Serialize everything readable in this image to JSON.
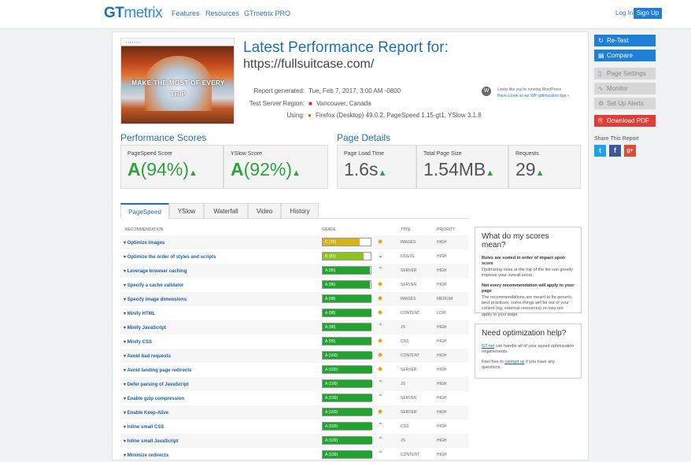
{
  "header": {
    "logo_gt": "GT",
    "logo_rest": "metrix",
    "nav": [
      "Features",
      "Resources",
      "GTmetrix PRO"
    ],
    "login": "Log In",
    "signup": "Sign Up"
  },
  "thumbnail": {
    "headline1": "MAKE THE MOST OF EVERY",
    "headline2": "TRIP"
  },
  "report": {
    "title": "Latest Performance Report for:",
    "url": "https://fullsuitcase.com/",
    "meta": [
      {
        "k": "Report generated:",
        "v": "Tue, Feb 7, 2017, 3:00 AM -0800"
      },
      {
        "k": "Test Server Region:",
        "v": "Vancouver, Canada"
      },
      {
        "k": "Using:",
        "v": "Firefox (Desktop) 49.0.2, PageSpeed 1.15-gt1, YSlow 3.1.8"
      }
    ],
    "wp_line1": "Looks like you're running WordPress",
    "wp_line2": "Have a look at our WP optimization tips »"
  },
  "perf": {
    "heading": "Performance Scores",
    "pagespeed": {
      "label": "PageSpeed Score",
      "grade": "A",
      "pct": "(94%)"
    },
    "yslow": {
      "label": "YSlow Score",
      "grade": "A",
      "pct": "(92%)"
    }
  },
  "details": {
    "heading": "Page Details",
    "load": {
      "label": "Page Load Time",
      "value": "1.6s"
    },
    "size": {
      "label": "Total Page Size",
      "value": "1.54MB"
    },
    "requests": {
      "label": "Requests",
      "value": "29"
    }
  },
  "tabs": [
    "PageSpeed",
    "YSlow",
    "Waterfall",
    "Video",
    "History"
  ],
  "table": {
    "headers": {
      "rec": "RECOMMENDATION",
      "grade": "GRADE",
      "type": "TYPE",
      "priority": "PRIORITY"
    },
    "rows": [
      {
        "name": "Optimize images",
        "grade": "C (75)",
        "score": 75,
        "color": "#d5b21c",
        "dir": "diamond",
        "type": "IMAGES",
        "priority": "HIGH"
      },
      {
        "name": "Optimize the order of styles and scripts",
        "grade": "B (83)",
        "score": 83,
        "color": "#8bc31e",
        "dir": "down",
        "type": "CSS/JS",
        "priority": "HIGH"
      },
      {
        "name": "Leverage browser caching",
        "grade": "A (96)",
        "score": 96,
        "color": "#22a22e",
        "dir": "up",
        "type": "SERVER",
        "priority": "HIGH"
      },
      {
        "name": "Specify a cache validator",
        "grade": "A (96)",
        "score": 96,
        "color": "#22a22e",
        "dir": "diamond",
        "type": "SERVER",
        "priority": "HIGH"
      },
      {
        "name": "Specify image dimensions",
        "grade": "A (98)",
        "score": 98,
        "color": "#22a22e",
        "dir": "diamond",
        "type": "IMAGES",
        "priority": "MEDIUM"
      },
      {
        "name": "Minify HTML",
        "grade": "A (98)",
        "score": 98,
        "color": "#22a22e",
        "dir": "diamond",
        "type": "CONTENT",
        "priority": "LOW"
      },
      {
        "name": "Minify JavaScript",
        "grade": "A (98)",
        "score": 98,
        "color": "#22a22e",
        "dir": "up",
        "type": "JS",
        "priority": "HIGH"
      },
      {
        "name": "Minify CSS",
        "grade": "A (99)",
        "score": 99,
        "color": "#22a22e",
        "dir": "diamond",
        "type": "CSS",
        "priority": "HIGH"
      },
      {
        "name": "Avoid bad requests",
        "grade": "A (100)",
        "score": 100,
        "color": "#22a22e",
        "dir": "diamond",
        "type": "CONTENT",
        "priority": "HIGH"
      },
      {
        "name": "Avoid landing page redirects",
        "grade": "A (100)",
        "score": 100,
        "color": "#22a22e",
        "dir": "diamond",
        "type": "SERVER",
        "priority": "HIGH"
      },
      {
        "name": "Defer parsing of JavaScript",
        "grade": "A (100)",
        "score": 100,
        "color": "#22a22e",
        "dir": "up",
        "type": "JS",
        "priority": "HIGH"
      },
      {
        "name": "Enable gzip compression",
        "grade": "A (100)",
        "score": 100,
        "color": "#22a22e",
        "dir": "up",
        "type": "SERVER",
        "priority": "HIGH"
      },
      {
        "name": "Enable Keep-Alive",
        "grade": "A (100)",
        "score": 100,
        "color": "#22a22e",
        "dir": "diamond",
        "type": "SERVER",
        "priority": "HIGH"
      },
      {
        "name": "Inline small CSS",
        "grade": "A (100)",
        "score": 100,
        "color": "#22a22e",
        "dir": "up",
        "type": "CSS",
        "priority": "HIGH"
      },
      {
        "name": "Inline small JavaScript",
        "grade": "A (100)",
        "score": 100,
        "color": "#22a22e",
        "dir": "up",
        "type": "JS",
        "priority": "HIGH"
      },
      {
        "name": "Minimize redirects",
        "grade": "A (100)",
        "score": 100,
        "color": "#22a22e",
        "dir": "up",
        "type": "CONTENT",
        "priority": "HIGH"
      }
    ]
  },
  "box1": {
    "title": "What do my scores mean?",
    "b1": "Rules are sorted in order of impact upon score",
    "t1": "Optimizing rules at the top of the list can greatly improve your overall score.",
    "b2": "Not every recommendation will apply to your page",
    "t2": "The recommendations are meant to be generic, best practices; some things will be out of your control (eg. external resources) or may not apply to your page."
  },
  "box2": {
    "title": "Need optimization help?",
    "link1": "GT.net",
    "t1": " can handle all of your speed optimization requirements.",
    "pre2": "Feel free to ",
    "link2": "contact us",
    "post2": " if you have any questions."
  },
  "sidebar": {
    "retest": "Re-Test",
    "compare": "Compare",
    "settings": "Page Settings",
    "monitor": "Monitor",
    "alerts": "Set Up Alerts",
    "pdf": "Download PDF",
    "share": "Share This Report"
  }
}
